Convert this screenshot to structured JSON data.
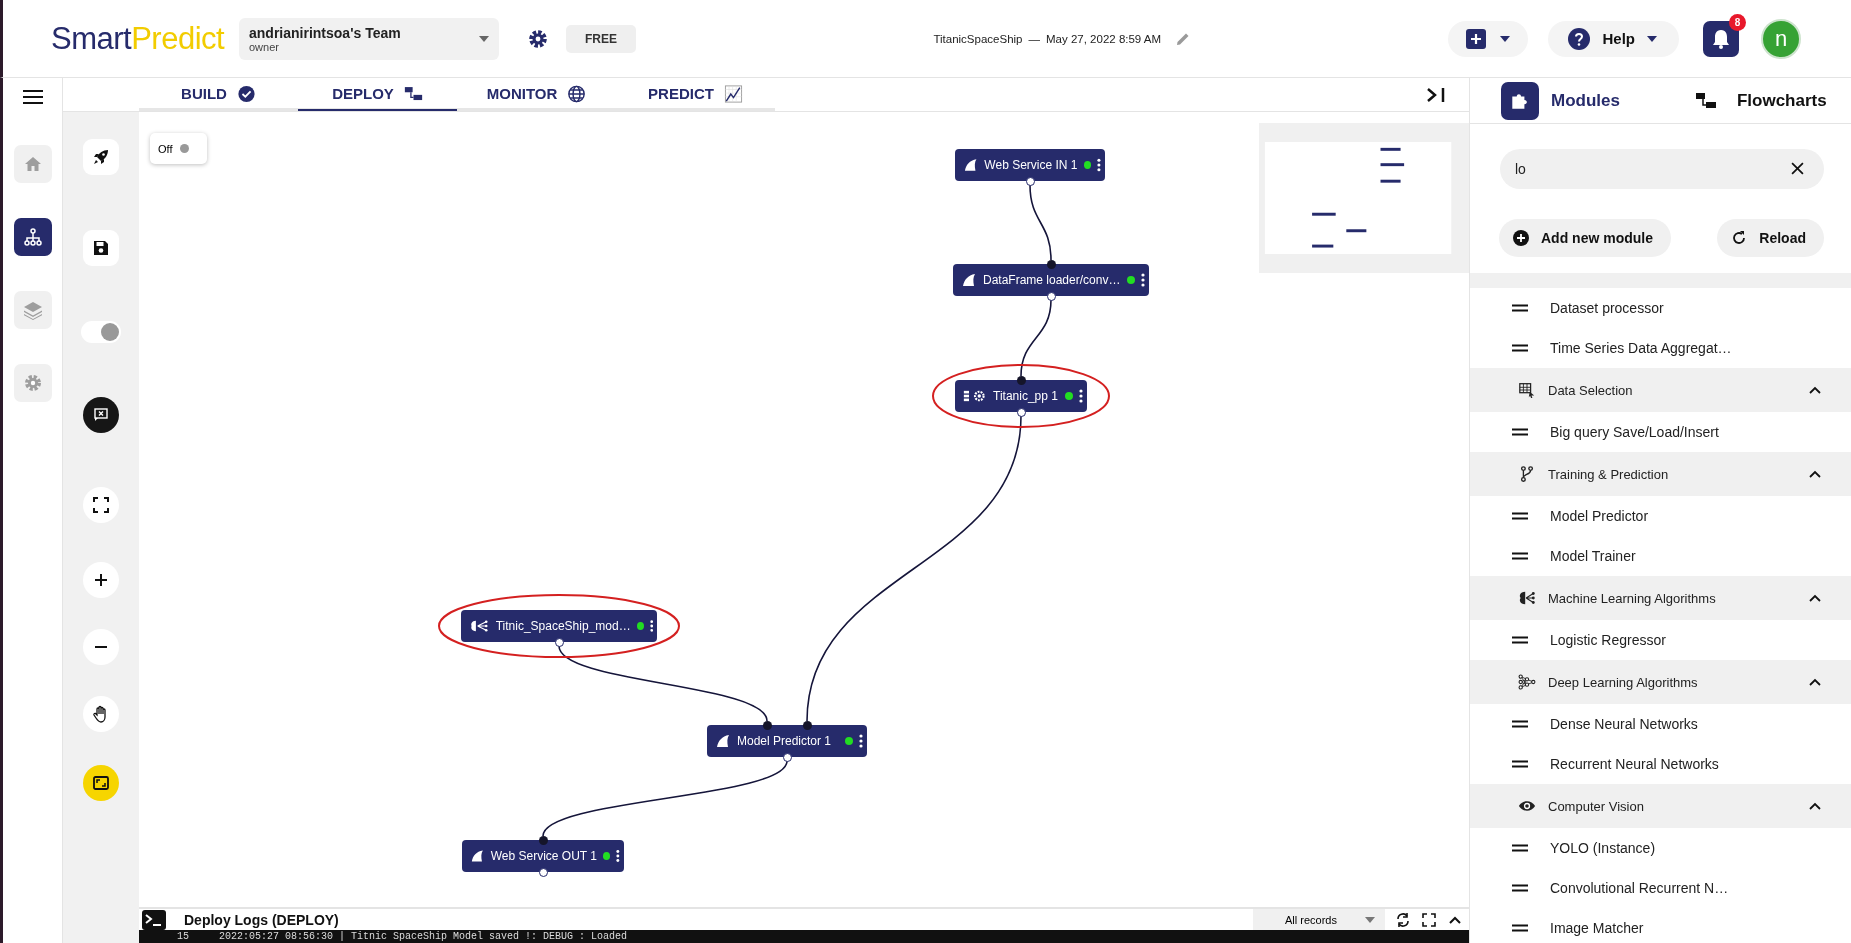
{
  "header": {
    "logo": [
      "Smart",
      "Predict"
    ],
    "team": {
      "name": "andrianirintsoa's Team",
      "role": "owner"
    },
    "plan": "FREE",
    "project": {
      "name": "TitanicSpaceShip",
      "separator": "—",
      "date": "May 27, 2022 8:59 AM"
    },
    "help": "Help",
    "notifications": {
      "count": "8"
    },
    "avatar": {
      "initial": "n"
    }
  },
  "nav_rail": [
    {
      "kind": "home",
      "selected": false
    },
    {
      "kind": "flow",
      "selected": true
    },
    {
      "kind": "layers",
      "selected": false
    },
    {
      "kind": "settings",
      "selected": false
    }
  ],
  "tools": [
    {
      "kind": "deploy",
      "selected": false
    },
    {
      "kind": "save",
      "selected": false
    },
    {
      "kind": "toggle",
      "on": true
    },
    {
      "kind": "clear-logs",
      "selected": false
    },
    {
      "kind": "fullscreen",
      "selected": false
    },
    {
      "kind": "zoom-in",
      "selected": false
    },
    {
      "kind": "zoom-out",
      "selected": false
    },
    {
      "kind": "pan",
      "selected": false
    },
    {
      "kind": "fit",
      "selected": true
    }
  ],
  "tabs": [
    {
      "label": "BUILD",
      "kind": "check",
      "selected": false
    },
    {
      "label": "DEPLOY",
      "kind": "flow",
      "selected": true
    },
    {
      "label": "MONITOR",
      "kind": "globe",
      "selected": false
    },
    {
      "label": "PREDICT",
      "kind": "chart",
      "selected": false
    }
  ],
  "canvas": {
    "live_toggle": {
      "label": "Off",
      "on": false
    },
    "nodes": [
      {
        "label": "Web Service IN 1",
        "kind": "fin",
        "color": "#22dd22",
        "circled": false
      },
      {
        "label": "DataFrame loader/conv…",
        "kind": "fin",
        "color": "#22dd22",
        "circled": false
      },
      {
        "label": "Titanic_pp 1",
        "kind": "processor",
        "color": "#22dd22",
        "circled": true
      },
      {
        "label": "Titnic_SpaceShip_mod…",
        "kind": "brain",
        "color": "#22dd22",
        "circled": true
      },
      {
        "label": "Model Predictor 1",
        "kind": "fin",
        "color": "#22dd22",
        "circled": false
      },
      {
        "label": "Web Service OUT 1",
        "kind": "fin",
        "color": "#22dd22",
        "circled": false
      }
    ]
  },
  "right_panel": {
    "tabs": [
      {
        "label": "Modules",
        "selected": true
      },
      {
        "label": "Flowcharts",
        "selected": false
      }
    ],
    "search": {
      "value": "lo"
    },
    "buttons": [
      {
        "label": "Add new module",
        "kind": "plus"
      },
      {
        "label": "Reload",
        "kind": "reload"
      }
    ],
    "groups": [
      {
        "expanded": true,
        "items": [
          "Dataset processor",
          "Time Series Data Aggregat…"
        ]
      },
      {
        "label": "Data Selection",
        "kind": "table",
        "expanded": true,
        "items": [
          "Big query Save/Load/Insert"
        ]
      },
      {
        "label": "Training & Prediction",
        "kind": "branch",
        "expanded": true,
        "items": [
          "Model Predictor",
          "Model Trainer"
        ]
      },
      {
        "label": "Machine Learning Algorithms",
        "kind": "brain",
        "expanded": true,
        "items": [
          "Logistic Regressor"
        ]
      },
      {
        "label": "Deep Learning Algorithms",
        "kind": "network",
        "expanded": true,
        "items": [
          "Dense Neural Networks",
          "Recurrent Neural Networks"
        ]
      },
      {
        "label": "Computer Vision",
        "kind": "eye",
        "expanded": true,
        "items": [
          "YOLO (Instance)",
          "Convolutional Recurrent N…",
          "Image Matcher"
        ]
      }
    ]
  },
  "logs": {
    "title": "Deploy Logs (DEPLOY)",
    "filter": "All records",
    "lines": [
      {
        "number": "15",
        "text": "2022:05:27 08:56:30 | Titnic SpaceShip Model saved !: DEBUG : Loaded"
      }
    ]
  }
}
